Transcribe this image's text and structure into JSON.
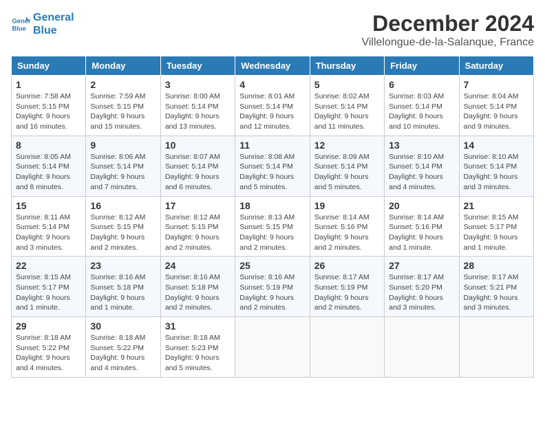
{
  "header": {
    "logo_line1": "General",
    "logo_line2": "Blue",
    "month_title": "December 2024",
    "location": "Villelongue-de-la-Salanque, France"
  },
  "weekdays": [
    "Sunday",
    "Monday",
    "Tuesday",
    "Wednesday",
    "Thursday",
    "Friday",
    "Saturday"
  ],
  "weeks": [
    [
      {
        "day": "1",
        "sunrise": "7:58 AM",
        "sunset": "5:15 PM",
        "daylight": "9 hours and 16 minutes."
      },
      {
        "day": "2",
        "sunrise": "7:59 AM",
        "sunset": "5:15 PM",
        "daylight": "9 hours and 15 minutes."
      },
      {
        "day": "3",
        "sunrise": "8:00 AM",
        "sunset": "5:14 PM",
        "daylight": "9 hours and 13 minutes."
      },
      {
        "day": "4",
        "sunrise": "8:01 AM",
        "sunset": "5:14 PM",
        "daylight": "9 hours and 12 minutes."
      },
      {
        "day": "5",
        "sunrise": "8:02 AM",
        "sunset": "5:14 PM",
        "daylight": "9 hours and 11 minutes."
      },
      {
        "day": "6",
        "sunrise": "8:03 AM",
        "sunset": "5:14 PM",
        "daylight": "9 hours and 10 minutes."
      },
      {
        "day": "7",
        "sunrise": "8:04 AM",
        "sunset": "5:14 PM",
        "daylight": "9 hours and 9 minutes."
      }
    ],
    [
      {
        "day": "8",
        "sunrise": "8:05 AM",
        "sunset": "5:14 PM",
        "daylight": "9 hours and 8 minutes."
      },
      {
        "day": "9",
        "sunrise": "8:06 AM",
        "sunset": "5:14 PM",
        "daylight": "9 hours and 7 minutes."
      },
      {
        "day": "10",
        "sunrise": "8:07 AM",
        "sunset": "5:14 PM",
        "daylight": "9 hours and 6 minutes."
      },
      {
        "day": "11",
        "sunrise": "8:08 AM",
        "sunset": "5:14 PM",
        "daylight": "9 hours and 5 minutes."
      },
      {
        "day": "12",
        "sunrise": "8:09 AM",
        "sunset": "5:14 PM",
        "daylight": "9 hours and 5 minutes."
      },
      {
        "day": "13",
        "sunrise": "8:10 AM",
        "sunset": "5:14 PM",
        "daylight": "9 hours and 4 minutes."
      },
      {
        "day": "14",
        "sunrise": "8:10 AM",
        "sunset": "5:14 PM",
        "daylight": "9 hours and 3 minutes."
      }
    ],
    [
      {
        "day": "15",
        "sunrise": "8:11 AM",
        "sunset": "5:14 PM",
        "daylight": "9 hours and 3 minutes."
      },
      {
        "day": "16",
        "sunrise": "8:12 AM",
        "sunset": "5:15 PM",
        "daylight": "9 hours and 2 minutes."
      },
      {
        "day": "17",
        "sunrise": "8:12 AM",
        "sunset": "5:15 PM",
        "daylight": "9 hours and 2 minutes."
      },
      {
        "day": "18",
        "sunrise": "8:13 AM",
        "sunset": "5:15 PM",
        "daylight": "9 hours and 2 minutes."
      },
      {
        "day": "19",
        "sunrise": "8:14 AM",
        "sunset": "5:16 PM",
        "daylight": "9 hours and 2 minutes."
      },
      {
        "day": "20",
        "sunrise": "8:14 AM",
        "sunset": "5:16 PM",
        "daylight": "9 hours and 1 minute."
      },
      {
        "day": "21",
        "sunrise": "8:15 AM",
        "sunset": "5:17 PM",
        "daylight": "9 hours and 1 minute."
      }
    ],
    [
      {
        "day": "22",
        "sunrise": "8:15 AM",
        "sunset": "5:17 PM",
        "daylight": "9 hours and 1 minute."
      },
      {
        "day": "23",
        "sunrise": "8:16 AM",
        "sunset": "5:18 PM",
        "daylight": "9 hours and 1 minute."
      },
      {
        "day": "24",
        "sunrise": "8:16 AM",
        "sunset": "5:18 PM",
        "daylight": "9 hours and 2 minutes."
      },
      {
        "day": "25",
        "sunrise": "8:16 AM",
        "sunset": "5:19 PM",
        "daylight": "9 hours and 2 minutes."
      },
      {
        "day": "26",
        "sunrise": "8:17 AM",
        "sunset": "5:19 PM",
        "daylight": "9 hours and 2 minutes."
      },
      {
        "day": "27",
        "sunrise": "8:17 AM",
        "sunset": "5:20 PM",
        "daylight": "9 hours and 3 minutes."
      },
      {
        "day": "28",
        "sunrise": "8:17 AM",
        "sunset": "5:21 PM",
        "daylight": "9 hours and 3 minutes."
      }
    ],
    [
      {
        "day": "29",
        "sunrise": "8:18 AM",
        "sunset": "5:22 PM",
        "daylight": "9 hours and 4 minutes."
      },
      {
        "day": "30",
        "sunrise": "8:18 AM",
        "sunset": "5:22 PM",
        "daylight": "9 hours and 4 minutes."
      },
      {
        "day": "31",
        "sunrise": "8:18 AM",
        "sunset": "5:23 PM",
        "daylight": "9 hours and 5 minutes."
      },
      null,
      null,
      null,
      null
    ]
  ],
  "labels": {
    "sunrise": "Sunrise:",
    "sunset": "Sunset:",
    "daylight": "Daylight:"
  }
}
